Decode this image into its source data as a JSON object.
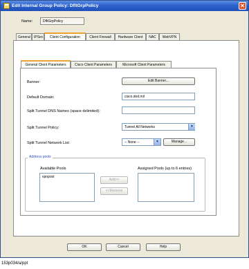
{
  "window": {
    "title": "Edit Internal Group Policy: DfltGrpPolicy",
    "close_label": "✕"
  },
  "name_label": "Name:",
  "name_value": "DfltGrpPolicy",
  "tabs": [
    "General",
    "IPSec",
    "Client Configuration",
    "Client Firewall",
    "Hardware Client",
    "NAC",
    "WebVPN"
  ],
  "subtabs": [
    "General Client Parameters",
    "Cisco Client Parameters",
    "Microsoft Client Parameters"
  ],
  "form": {
    "banner_label": "Banner:",
    "banner_button": "Edit Banner...",
    "domain_label": "Default Domain:",
    "domain_value": "cisco.dod.mil",
    "dns_label": "Split Tunnel DNS Names (space delimited):",
    "dns_value": "",
    "policy_label": "Split Tunnel Policy:",
    "policy_value": "Tunnel All Networks",
    "netlist_label": "Split Tunnel Network List:",
    "netlist_value": "-- None --",
    "manage_button": "Manage..."
  },
  "address_pools": {
    "title": "Address pools",
    "available_label": "Available Pools",
    "available_items": [
      "vpnpool"
    ],
    "add_button": "Add>>",
    "remove_button": "<<Remove",
    "assigned_label": "Assigned Pools (up to 6 entries)",
    "assigned_items": []
  },
  "footer": {
    "ok": "OK",
    "cancel": "Cancel",
    "help": "Help"
  },
  "caption": "153p034/a/ppt",
  "colors": {
    "titlebar": "#2d62cf",
    "active_tab_accent": "#f0a030",
    "group_title": "#3050c0"
  }
}
